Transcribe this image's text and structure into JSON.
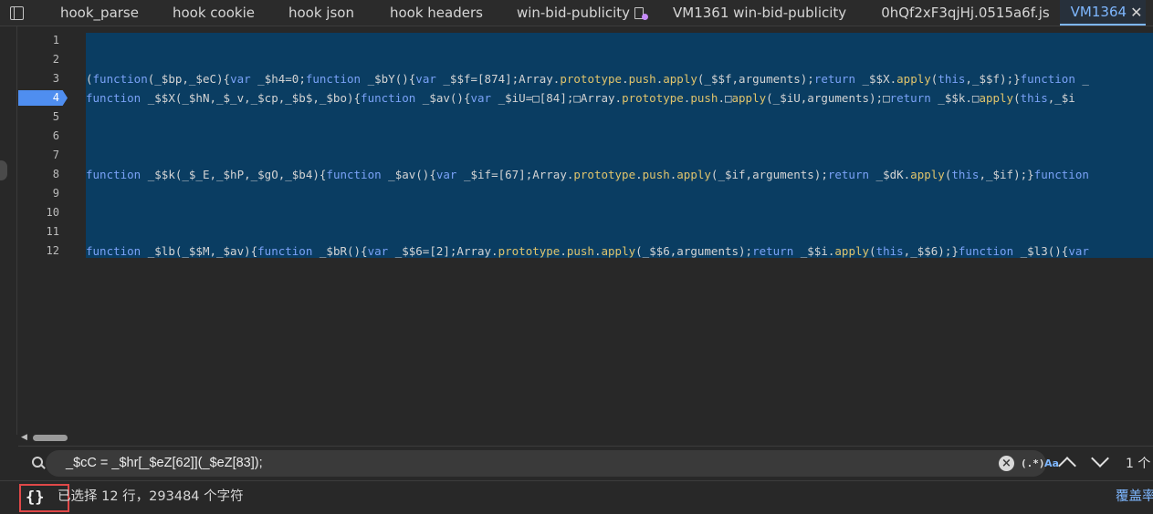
{
  "tabs": [
    {
      "label": "hook_parse"
    },
    {
      "label": "hook cookie"
    },
    {
      "label": "hook json"
    },
    {
      "label": "hook headers"
    },
    {
      "label": "win-bid-publicity"
    },
    {
      "label": "VM1361 win-bid-publicity"
    },
    {
      "label": "0hQf2xF3qjHj.0515a6f.js"
    },
    {
      "label": "VM1364",
      "active": true
    }
  ],
  "editor": {
    "current_line": 4,
    "lines": [
      {
        "n": "1",
        "code": ""
      },
      {
        "n": "2",
        "code": ""
      },
      {
        "n": "3",
        "code": "(function(_$bp,_$eC){var _$h4=0;function _$bY(){var _$$f=[874];Array.prototype.push.apply(_$$f,arguments);return _$$X.apply(this,_$$f);}function _"
      },
      {
        "n": "4",
        "code": "function _$$X(_$hN,_$_v,_$cp,_$b$,_$bo){function _$av(){var _$iU=□[84];□Array.prototype.push.□apply(_$iU,arguments);□return _$$k.□apply(this,_$i"
      },
      {
        "n": "5",
        "code": ""
      },
      {
        "n": "6",
        "code": ""
      },
      {
        "n": "7",
        "code": ""
      },
      {
        "n": "8",
        "code": "function _$$k(_$_E,_$hP,_$gO,_$b4){function _$av(){var _$if=[67];Array.prototype.push.apply(_$if,arguments);return _$dK.apply(this,_$if);}function"
      },
      {
        "n": "9",
        "code": ""
      },
      {
        "n": "10",
        "code": ""
      },
      {
        "n": "11",
        "code": ""
      },
      {
        "n": "12",
        "code": "function _$lb(_$$M,_$av){function _$bR(){var _$$6=[2];Array.prototype.push.apply(_$$6,arguments);return _$$i.apply(this,_$$6);}function _$l3(){var"
      }
    ]
  },
  "search": {
    "query": "_$cC = _$hr[_$eZ[62]](_$eZ[83]);",
    "regex_label": "(.*)",
    "case_label": "Aa",
    "match_count": "1 个"
  },
  "status": {
    "pretty_print_label": "{}",
    "selection_text": "已选择 12 行，293484 个字符",
    "coverage_label": "覆盖率"
  },
  "colors": {
    "selection": "#0a3d62",
    "accent": "#7eb7ff",
    "highlight_box": "#e04848"
  }
}
